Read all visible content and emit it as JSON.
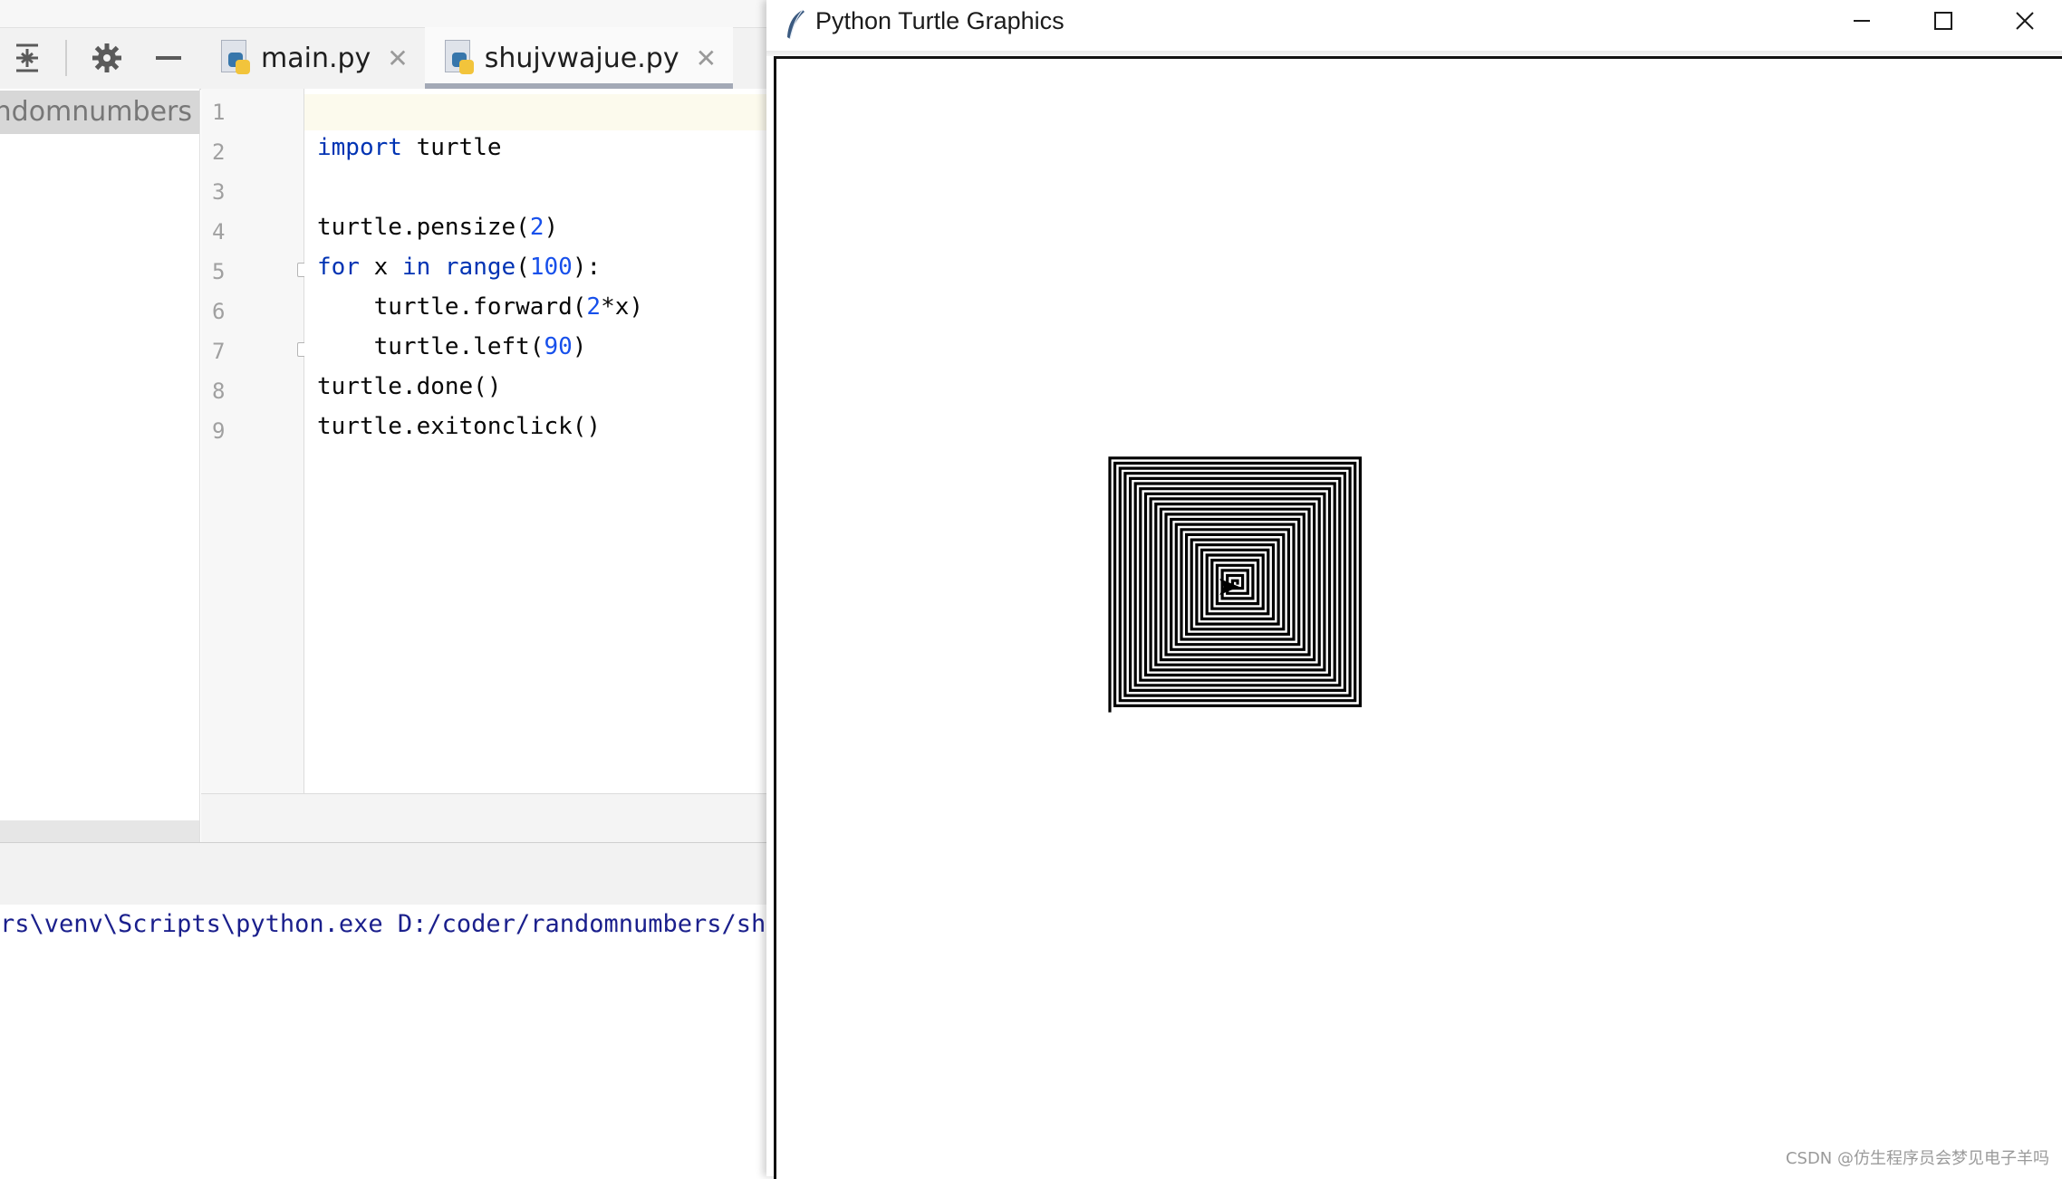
{
  "ide": {
    "tabs": [
      {
        "label": "main.py",
        "active": false
      },
      {
        "label": "shujvwajue.py",
        "active": true
      }
    ],
    "project_root": "randomnumbers",
    "line_numbers": [
      "1",
      "2",
      "3",
      "4",
      "5",
      "6",
      "7",
      "8",
      "9"
    ],
    "console_output": "rs\\venv\\Scripts\\python.exe D:/coder/randomnumbers/shu",
    "toolbar_icons": [
      "collapse-all-icon",
      "gear-icon",
      "minimize-panel-icon"
    ]
  },
  "code": {
    "line2": {
      "kw": "import",
      "rest": " turtle"
    },
    "line4": {
      "a": "turtle.pensize(",
      "n": "2",
      "b": ")"
    },
    "line5": {
      "kw1": "for",
      "a": " x ",
      "kw2": "in",
      "b": " ",
      "fn": "range",
      "c": "(",
      "n": "100",
      "d": "):"
    },
    "line6": {
      "a": "    turtle.forward(",
      "n": "2",
      "b": "*x)"
    },
    "line7": {
      "a": "    turtle.left(",
      "n": "90",
      "b": ")"
    },
    "line8": "turtle.done()",
    "line9": "turtle.exitonclick()"
  },
  "turtle_window": {
    "title": "Python Turtle Graphics",
    "buttons": [
      "minimize",
      "maximize",
      "close"
    ],
    "drawing": {
      "pensize": 2,
      "iterations": 100,
      "step_multiplier": 2,
      "turn_degrees": 90,
      "pen_color": "#000000"
    }
  },
  "watermark": "CSDN @仿生程序员会梦见电子羊吗"
}
